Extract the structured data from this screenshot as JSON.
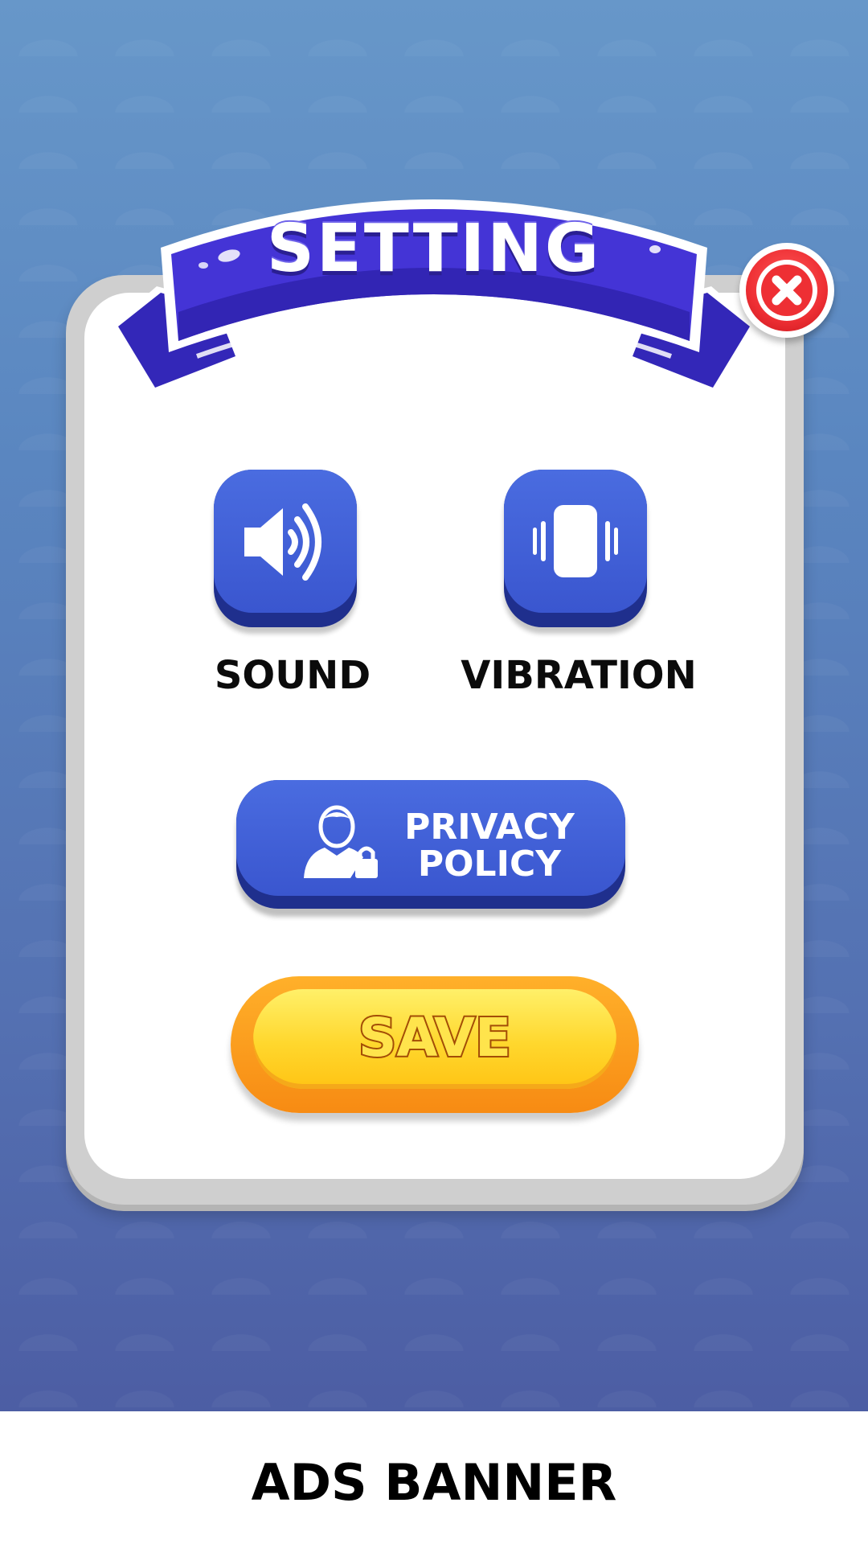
{
  "title": "SETTING",
  "close": {
    "icon": "close-icon"
  },
  "toggles": [
    {
      "label": "SOUND",
      "icon": "speaker-icon"
    },
    {
      "label": "VIBRATION",
      "icon": "vibration-icon"
    }
  ],
  "privacy": {
    "line1": "PRIVACY",
    "line2": "POLICY",
    "icon": "user-lock-icon"
  },
  "save": {
    "label": "SAVE"
  },
  "ads": {
    "label": "ADS BANNER"
  },
  "colors": {
    "background": "#5a86c0",
    "ribbon": "#4434d6",
    "button_blue": "#3a56cf",
    "close_red": "#ee2f34",
    "save_yellow": "#ffd72d",
    "save_orange": "#f78b13"
  }
}
